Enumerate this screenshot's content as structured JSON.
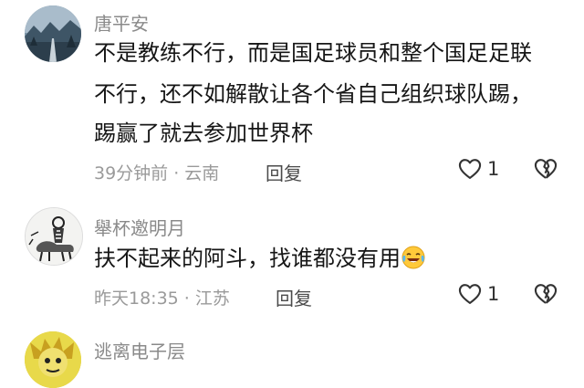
{
  "comments": [
    {
      "username": "唐平安",
      "lines": [
        "不是教练不行，而是国足球员和整个国足足联",
        "不行，还不如解散让各个省自己组织球队踢，",
        "踢赢了就去参加世界杯"
      ],
      "time": "39分钟前",
      "location": "云南",
      "reply_label": "回复",
      "like_count": "1"
    },
    {
      "username": "舉杯邀明月",
      "lines": [
        "扶不起来的阿斗，找谁都没有用"
      ],
      "emoji": "laughing-crying-emoji",
      "time": "昨天18:35",
      "location": "江苏",
      "reply_label": "回复",
      "like_count": "1"
    },
    {
      "username": "逃离电子层"
    }
  ],
  "colors": {
    "username": "#8a8a8a",
    "meta": "#9a9a9a",
    "text": "#161616"
  }
}
